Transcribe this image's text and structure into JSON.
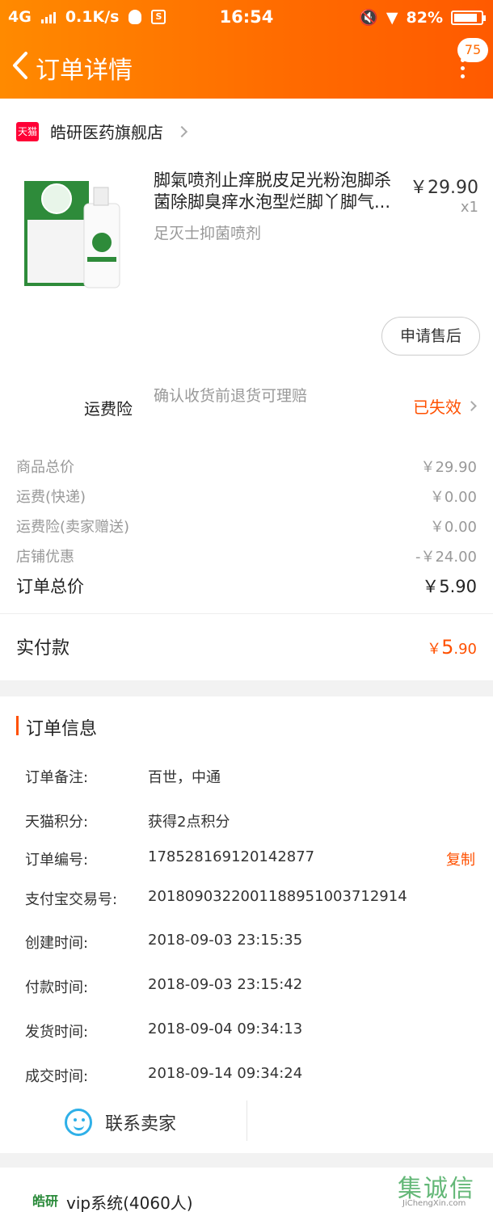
{
  "status_bar": {
    "network": "4G",
    "speed": "0.1K/s",
    "time": "16:54",
    "battery": "82%",
    "battery_level": 0.82
  },
  "header": {
    "title": "订单详情",
    "badge": "75"
  },
  "shop": {
    "logo": "天猫",
    "name": "皓研医药旗舰店"
  },
  "product": {
    "title": "脚氣喷剂止痒脱皮足光粉泡脚杀菌除脚臭痒水泡型烂脚丫脚气...",
    "sku": "足灭士抑菌喷剂",
    "price": "￥29.90",
    "qty": "x1",
    "after_sale": "申请售后"
  },
  "insurance": {
    "label": "运费险",
    "desc": "确认收货前退货可理赔",
    "status": "已失效"
  },
  "fees": [
    {
      "label": "商品总价",
      "value": "￥29.90"
    },
    {
      "label": "运费(快递)",
      "value": "￥0.00"
    },
    {
      "label": "运费险(卖家赠送)",
      "value": "￥0.00"
    },
    {
      "label": "店铺优惠",
      "value": "-￥24.00"
    }
  ],
  "total": {
    "label": "订单总价",
    "value": "￥5.90"
  },
  "paid": {
    "label": "实付款",
    "currency": "￥",
    "int": "5",
    "dec": ".90"
  },
  "info": {
    "title": "订单信息",
    "rows": [
      {
        "label": "订单备注:",
        "value": "百世，中通"
      },
      {
        "label": "天猫积分:",
        "value": "获得2点积分"
      },
      {
        "label": "订单编号:",
        "value": "178528169120142877"
      },
      {
        "label": "支付宝交易号:",
        "value": "2018090322001188951003712914"
      },
      {
        "label": "创建时间:",
        "value": "2018-09-03 23:15:35"
      },
      {
        "label": "付款时间:",
        "value": "2018-09-03 23:15:42"
      },
      {
        "label": "发货时间:",
        "value": "2018-09-04 09:34:13"
      },
      {
        "label": "成交时间:",
        "value": "2018-09-14 09:34:24"
      }
    ],
    "copy_label": "复制",
    "contact_label": "联系卖家"
  },
  "group": {
    "logo": "皓研",
    "name": "vip系统(4060人)"
  },
  "watermark": {
    "text": "集诚信",
    "sub": "JiChengXin.com"
  }
}
